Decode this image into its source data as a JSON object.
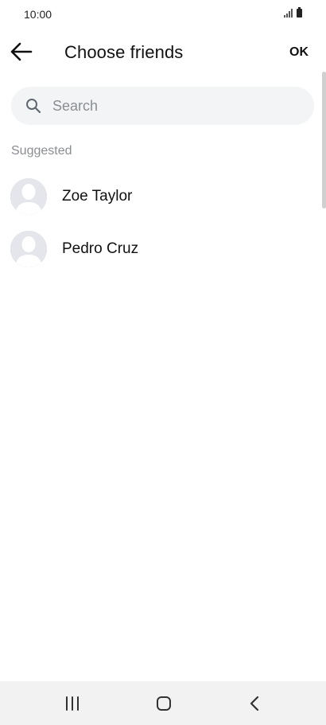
{
  "status_bar": {
    "time": "10:00",
    "signal_icon": "signal-icon",
    "battery_icon": "battery-icon"
  },
  "header": {
    "back_icon": "arrow-left-icon",
    "title": "Choose friends",
    "ok_label": "OK"
  },
  "search": {
    "placeholder": "Search",
    "value": "",
    "icon": "search-icon"
  },
  "suggested": {
    "label": "Suggested",
    "friends": [
      {
        "name": "Zoe Taylor",
        "avatar": "default-avatar-icon"
      },
      {
        "name": "Pedro Cruz",
        "avatar": "default-avatar-icon"
      }
    ]
  },
  "nav_bar": {
    "recents_icon": "recents-icon",
    "home_icon": "home-icon",
    "back_icon": "back-chevron-icon"
  },
  "colors": {
    "background": "#ffffff",
    "search_bg": "#f3f4f6",
    "secondary_text": "#8a8d91",
    "nav_bar_bg": "#f2f2f2"
  }
}
